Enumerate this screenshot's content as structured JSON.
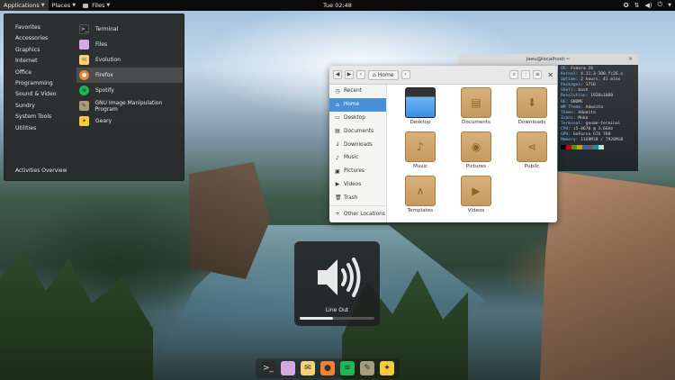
{
  "topbar": {
    "applications": "Applications",
    "places": "Places",
    "files": "Files",
    "clock": "Tue 02:48",
    "tray": [
      "accessibility-icon",
      "network-icon",
      "volume-icon",
      "power-icon"
    ]
  },
  "appmenu": {
    "categories": [
      "Favorites",
      "Accessories",
      "Graphics",
      "Internet",
      "Office",
      "Programming",
      "Sound & Video",
      "Sundry",
      "System Tools",
      "Utilities"
    ],
    "apps": [
      {
        "label": "Terminal",
        "icon": "terminal-icon",
        "color": "#2b2b2b"
      },
      {
        "label": "Files",
        "icon": "files-icon",
        "color": "#d7a9e3"
      },
      {
        "label": "Evolution",
        "icon": "evolution-icon",
        "color": "#f5d27a"
      },
      {
        "label": "Firefox",
        "icon": "firefox-icon",
        "color": "#f0812f"
      },
      {
        "label": "Spotify",
        "icon": "spotify-icon",
        "color": "#1db954"
      },
      {
        "label": "GNU Image Manipulation Program",
        "icon": "gimp-icon",
        "color": "#a89b7e"
      },
      {
        "label": "Geary",
        "icon": "geary-icon",
        "color": "#f7c93c"
      }
    ],
    "activities": "Activities Overview"
  },
  "terminal": {
    "title": "jaeu@localhost:~",
    "lines": [
      [
        "OS:",
        " Fedora 26"
      ],
      [
        "Kernel:",
        " 4.11.3-300.fc26.x"
      ],
      [
        "Uptime:",
        " 2 hours, 41 mins"
      ],
      [
        "Packages:",
        " 1710"
      ],
      [
        "Shell:",
        " bash"
      ],
      [
        "Resolution:",
        " 1920x1080"
      ],
      [
        "DE:",
        " GNOME"
      ],
      [
        "WM Theme:",
        " Adwaita"
      ],
      [
        "Theme:",
        " Adwaita"
      ],
      [
        "Icons:",
        " Moka"
      ],
      [
        "Terminal:",
        " gnome-terminal"
      ],
      [
        "CPU:",
        " i5-4670 @ 3.6GHz"
      ],
      [
        "GPU:",
        " GeForce GTX 760"
      ],
      [
        "Memory:",
        " 1168MiB / 7920MiB"
      ]
    ],
    "palette": [
      "#000000",
      "#cc0000",
      "#4e9a06",
      "#c4a000",
      "#3465a4",
      "#75507b",
      "#06989a",
      "#d3d7cf"
    ]
  },
  "files": {
    "path": "Home",
    "sidebar": [
      {
        "label": "Recent",
        "icon": "clock-icon"
      },
      {
        "label": "Home",
        "icon": "home-icon"
      },
      {
        "label": "Desktop",
        "icon": "desktop-icon"
      },
      {
        "label": "Documents",
        "icon": "documents-icon"
      },
      {
        "label": "Downloads",
        "icon": "downloads-icon"
      },
      {
        "label": "Music",
        "icon": "music-icon"
      },
      {
        "label": "Pictures",
        "icon": "pictures-icon"
      },
      {
        "label": "Videos",
        "icon": "videos-icon"
      },
      {
        "label": "Trash",
        "icon": "trash-icon"
      },
      {
        "label": "Other Locations",
        "icon": "plus-icon"
      }
    ],
    "folders": [
      {
        "label": "Desktop",
        "icon": "desktop-folder-icon"
      },
      {
        "label": "Documents",
        "icon": "documents-folder-icon"
      },
      {
        "label": "Downloads",
        "icon": "downloads-folder-icon"
      },
      {
        "label": "Music",
        "icon": "music-folder-icon"
      },
      {
        "label": "Pictures",
        "icon": "pictures-folder-icon"
      },
      {
        "label": "Public",
        "icon": "public-folder-icon"
      },
      {
        "label": "Templates",
        "icon": "templates-folder-icon"
      },
      {
        "label": "Videos",
        "icon": "videos-folder-icon"
      }
    ]
  },
  "osd": {
    "label": "Line Out",
    "level": 0.45
  },
  "dock": [
    {
      "icon": "terminal-icon",
      "color": "#2b2b2b"
    },
    {
      "icon": "files-icon",
      "color": "#d7a9e3"
    },
    {
      "icon": "evolution-icon",
      "color": "#f5d27a"
    },
    {
      "icon": "firefox-icon",
      "color": "#f0812f"
    },
    {
      "icon": "spotify-icon",
      "color": "#1db954"
    },
    {
      "icon": "gimp-icon",
      "color": "#a89b7e"
    },
    {
      "icon": "geary-icon",
      "color": "#f7c93c"
    }
  ]
}
